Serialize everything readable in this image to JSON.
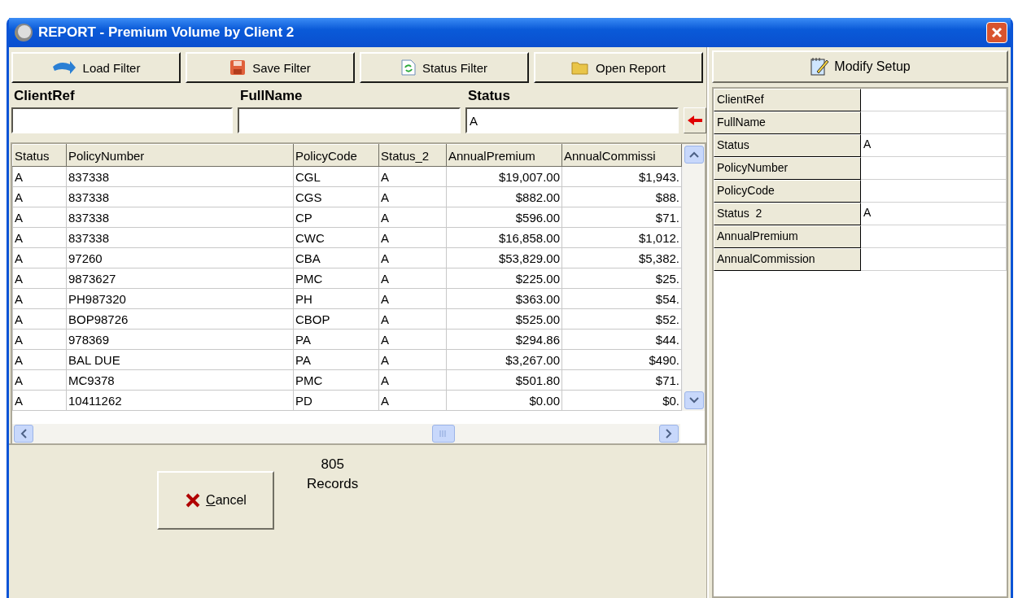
{
  "window": {
    "title": "REPORT - Premium Volume by Client 2"
  },
  "toolbar": [
    "Load Filter",
    "Save Filter",
    "Status Filter",
    "Open Report"
  ],
  "filters": [
    {
      "label": "ClientRef"
    },
    {
      "label": "FullName"
    },
    {
      "label": "Status",
      "value": "A"
    }
  ],
  "table": {
    "columns": [
      "Status",
      "PolicyNumber",
      "PolicyCode",
      "Status_2",
      "AnnualPremium",
      "AnnualCommissi"
    ],
    "rows": [
      [
        "A",
        "837338",
        "CGL",
        "A",
        "$19,007.00",
        "$1,943."
      ],
      [
        "A",
        "837338",
        "CGS",
        "A",
        "$882.00",
        "$88."
      ],
      [
        "A",
        "837338",
        "CP",
        "A",
        "$596.00",
        "$71."
      ],
      [
        "A",
        "837338",
        "CWC",
        "A",
        "$16,858.00",
        "$1,012."
      ],
      [
        "A",
        "97260",
        "CBA",
        "A",
        "$53,829.00",
        "$5,382."
      ],
      [
        "A",
        "9873627",
        "PMC",
        "A",
        "$225.00",
        "$25."
      ],
      [
        "A",
        "PH987320",
        "PH",
        "A",
        "$363.00",
        "$54."
      ],
      [
        "A",
        "BOP98726",
        "CBOP",
        "A",
        "$525.00",
        "$52."
      ],
      [
        "A",
        "978369",
        "PA",
        "A",
        "$294.86",
        "$44."
      ],
      [
        "A",
        "BAL DUE",
        "PA",
        "A",
        "$3,267.00",
        "$490."
      ],
      [
        "A",
        "MC9378",
        "PMC",
        "A",
        "$501.80",
        "$71."
      ],
      [
        "A",
        "10411262",
        "PD",
        "A",
        "$0.00",
        "$0."
      ]
    ]
  },
  "footer": {
    "cancel": "Cancel",
    "record_count": "805",
    "record_label": "Records"
  },
  "setup": {
    "button": "Modify Setup",
    "fields": [
      {
        "name": "ClientRef"
      },
      {
        "name": "FullName"
      },
      {
        "name": "Status",
        "value": "A"
      },
      {
        "name": "PolicyNumber"
      },
      {
        "name": "PolicyCode"
      },
      {
        "name": "Status  2",
        "value": "A"
      },
      {
        "name": "AnnualPremium"
      },
      {
        "name": "AnnualCommission"
      }
    ]
  }
}
